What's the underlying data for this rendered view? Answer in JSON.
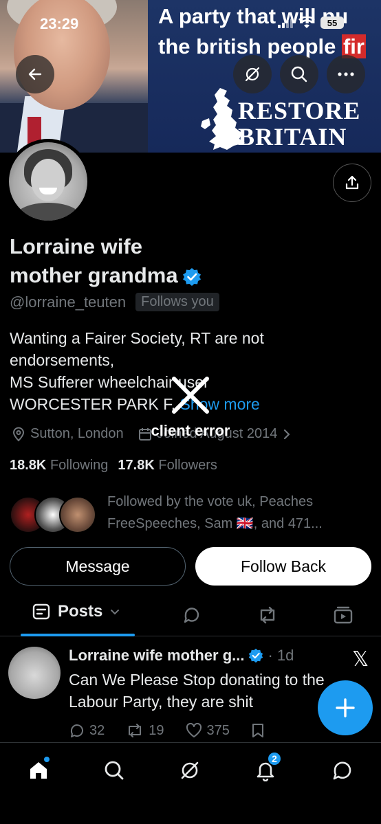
{
  "status_bar": {
    "time": "23:29",
    "battery": "55"
  },
  "banner": {
    "slogan_line1": "A party that will pu",
    "slogan_line2": "the british people ",
    "slogan_red": "fir",
    "brand_line1": "RESTORE",
    "brand_line2": "BRITAIN"
  },
  "profile": {
    "name_line1": "Lorraine wife",
    "name_line2": "mother grandma",
    "handle": "@lorraine_teuten",
    "follows_you": "Follows you",
    "bio_lines": [
      "Wanting a Fairer Society, RT are not",
      "endorsements,",
      "MS Sufferer wheelchair user",
      "WORCESTER PARK F."
    ],
    "show_more": "Show more",
    "location": "Sutton, London",
    "joined": "Joined August 2014",
    "following_count": "18.8K",
    "following_label": "Following",
    "followers_count": "17.8K",
    "followers_label": "Followers",
    "followed_by": "Followed by the vote uk, Peaches FreeSpeeches, Sam 🇬🇧, and 471..."
  },
  "error": {
    "text": "client error"
  },
  "actions": {
    "message": "Message",
    "follow_back": "Follow Back"
  },
  "tabs": {
    "posts": "Posts"
  },
  "post": {
    "name": "Lorraine wife mother g...",
    "time": "· 1d",
    "text": "Can We Please Stop donating to the Labour Party, they are shit",
    "replies": "32",
    "reposts": "19",
    "likes": "375"
  },
  "nav": {
    "notif_count": "2"
  },
  "colors": {
    "accent": "#1d9bf0",
    "background": "#000000",
    "muted": "#71767b"
  }
}
